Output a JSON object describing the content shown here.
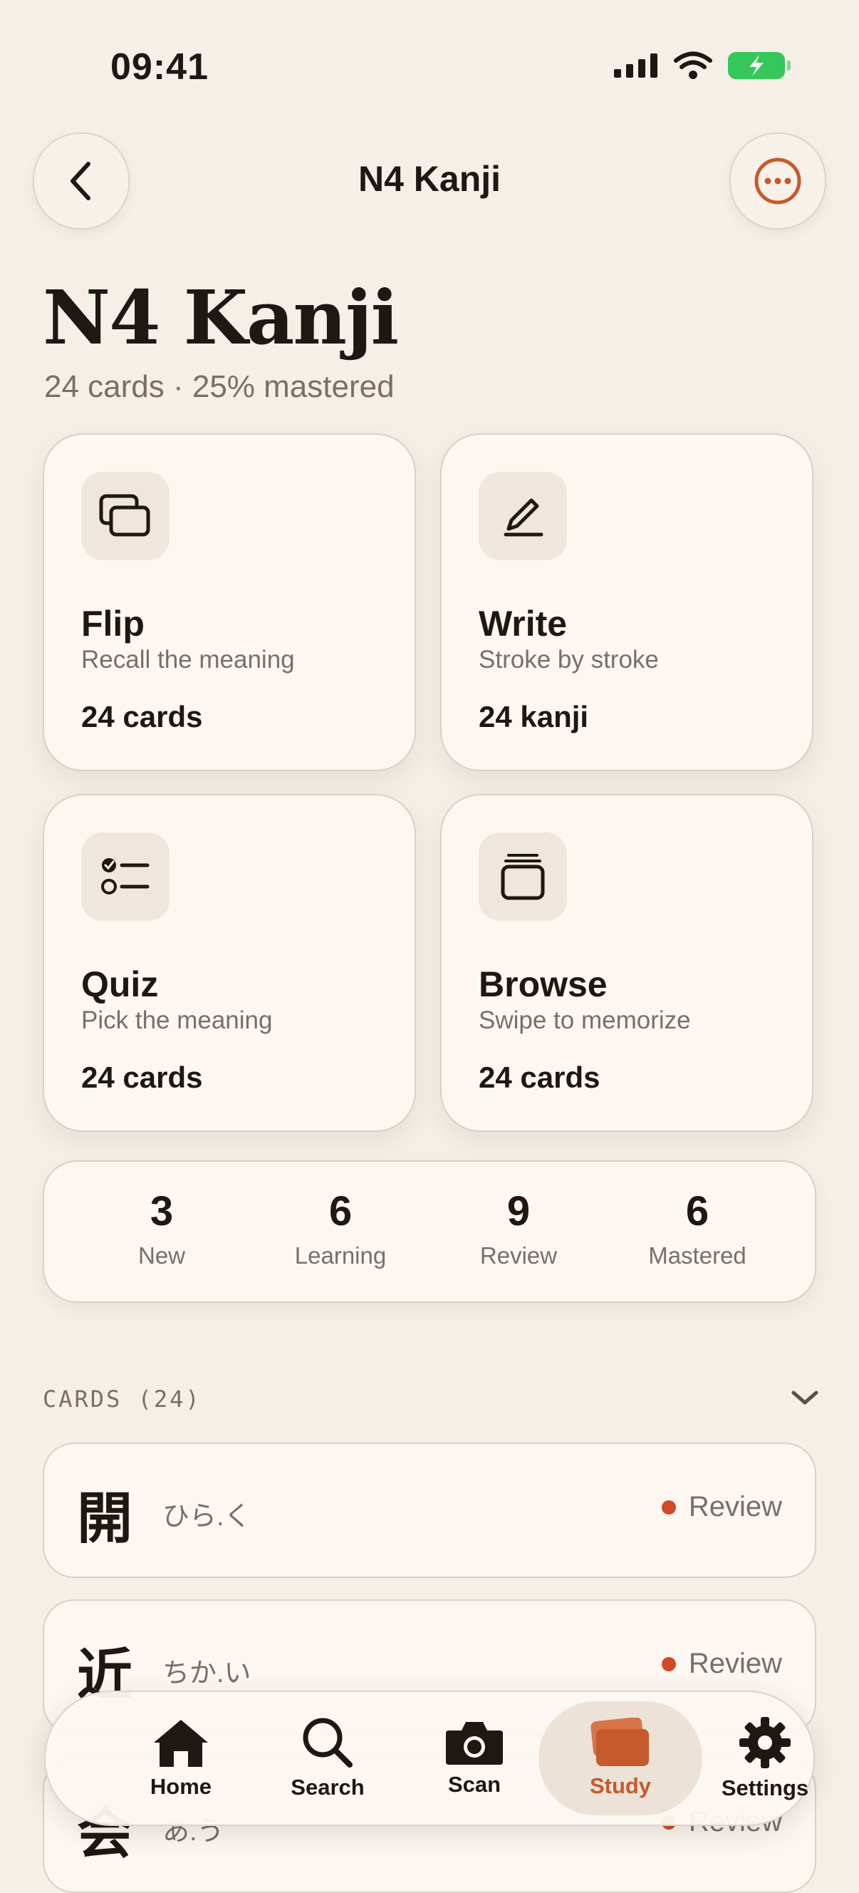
{
  "status_bar": {
    "time": "09:41"
  },
  "header": {
    "title": "N4 Kanji"
  },
  "page": {
    "title": "N4 Kanji",
    "subtitle": "24 cards · 25% mastered"
  },
  "modes": [
    {
      "title": "Flip",
      "subtitle": "Recall the meaning",
      "count": "24 cards",
      "icon": "cards-stack-icon"
    },
    {
      "title": "Write",
      "subtitle": "Stroke by stroke",
      "count": "24 kanji",
      "icon": "pen-icon"
    },
    {
      "title": "Quiz",
      "subtitle": "Pick the meaning",
      "count": "24 cards",
      "icon": "checklist-icon"
    },
    {
      "title": "Browse",
      "subtitle": "Swipe to memorize",
      "count": "24 cards",
      "icon": "card-deck-icon"
    }
  ],
  "stats": [
    {
      "value": "3",
      "label": "New"
    },
    {
      "value": "6",
      "label": "Learning"
    },
    {
      "value": "9",
      "label": "Review"
    },
    {
      "value": "6",
      "label": "Mastered"
    }
  ],
  "section": {
    "label": "CARDS (24)"
  },
  "cards": [
    {
      "kanji": "開",
      "reading": "ひら.く",
      "status": "Review"
    },
    {
      "kanji": "近",
      "reading": "ちか.い",
      "status": "Review"
    },
    {
      "kanji": "会",
      "reading": "あ.う",
      "status": "Review"
    }
  ],
  "tabs": [
    {
      "label": "Home",
      "icon": "house-icon"
    },
    {
      "label": "Search",
      "icon": "magnifier-icon"
    },
    {
      "label": "Scan",
      "icon": "camera-icon"
    },
    {
      "label": "Study",
      "icon": "study-cards-icon",
      "active": true
    },
    {
      "label": "Settings",
      "icon": "gear-icon"
    }
  ],
  "colors": {
    "accent": "#c65a2a",
    "background": "#f5efe7",
    "status_dot": "#d04a2a",
    "battery": "#34c759"
  }
}
